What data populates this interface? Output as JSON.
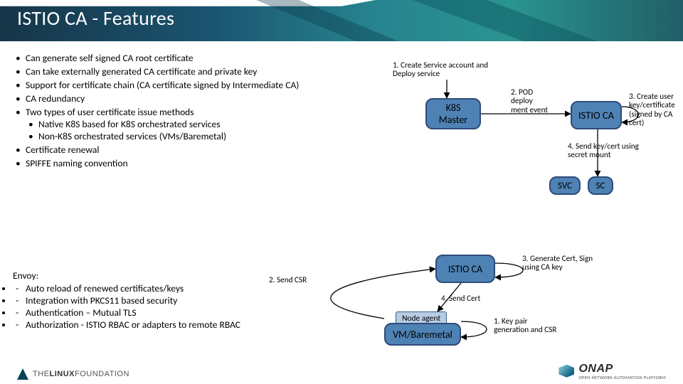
{
  "title": "ISTIO CA - Features",
  "bullets": {
    "b1": "Can generate self signed CA root certificate",
    "b2": "Can take externally generated CA certificate and private key",
    "b3": "Support for certificate chain (CA certificate signed by Intermediate CA)",
    "b4": "CA redundancy",
    "b5": "Two types of user certificate issue methods",
    "b5a": "Native K8S based for K8S orchestrated services",
    "b5b": "Non-K8S orchestrated services (VMs/Baremetal)",
    "b6": "Certificate renewal",
    "b7": "SPIFFE naming convention"
  },
  "envoy": {
    "title": "Envoy:",
    "e1": "Auto reload of renewed certificates/keys",
    "e2": "Integration with PKCS11 based security",
    "e3": "Authentication – Mutual TLS",
    "e4": "Authorization -  ISTIO RBAC or adapters to remote RBAC"
  },
  "diagram": {
    "k8s_master": "K8S Master",
    "istio_ca_top": "ISTIO CA",
    "svc": "SVC",
    "sc": "SC",
    "istio_ca_mid": "ISTIO CA",
    "node_agent": "Node agent",
    "vm_baremetal": "VM/Baremetal",
    "l1": "1. Create Service account and Deploy service",
    "l2": "2. POD deploy ment event",
    "l3": "3. Create user key/certificate (signed by CA cert)",
    "l4": "4. Send key/cert using secret mount",
    "l_svc3": "3. Generate Cert, Sign using CA key",
    "l_bm1": "1. Key pair generation and CSR",
    "l_bm2": "2. Send CSR",
    "l_bm4": "4. Send Cert"
  },
  "footer": {
    "linux_foundation": "THE LINUX FOUNDATION",
    "onap": "ONAP",
    "onap_sub": "OPEN NETWORK AUTOMATION PLATFORM"
  }
}
